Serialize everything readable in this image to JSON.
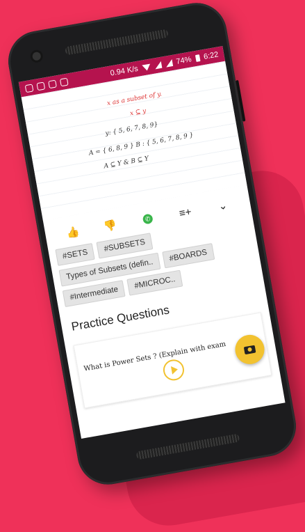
{
  "status": {
    "speed": "0.94 K/s",
    "battery": "74%",
    "time": "6:22"
  },
  "note": {
    "lines": [
      {
        "text": "x as a subset of y.",
        "red": true
      },
      {
        "text": "x ⊆ y",
        "red": true
      },
      {
        "text": "y: { 5, 6, 7, 8, 9}",
        "red": false
      },
      {
        "text": "A = { 6, 8, 9 }    B : { 5, 6, 7, 8, 9 }",
        "red": false
      },
      {
        "text": "A ⊆ Y  &  B ⊆ Y",
        "red": false
      }
    ]
  },
  "actions": {
    "like": "👍",
    "dislike": "👎",
    "whatsapp": "✆",
    "playlist": "≡+",
    "more": "⌄"
  },
  "tags": [
    "#SETS",
    "#SUBSETS",
    "Types of Subsets (defin..",
    "#BOARDS",
    "#Intermediate",
    "#MICROC.."
  ],
  "section_title": "Practice Questions",
  "question": "What is Power Sets ? (Explain with exam"
}
